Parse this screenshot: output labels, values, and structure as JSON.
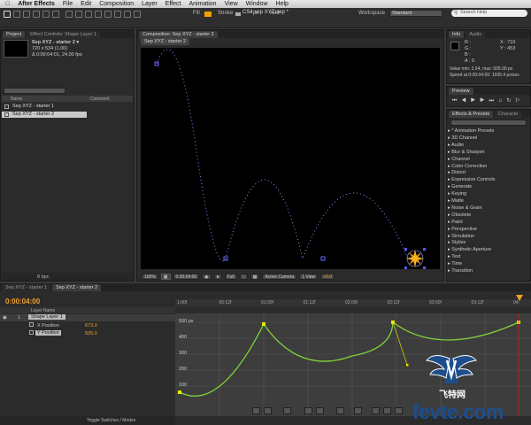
{
  "menubar": {
    "app": "After Effects",
    "items": [
      "File",
      "Edit",
      "Composition",
      "Layer",
      "Effect",
      "Animation",
      "View",
      "Window",
      "Help"
    ]
  },
  "window_title": "CS4 sep XYZ.aep *",
  "toolbar": {
    "fill": "Fill",
    "stroke": "Stroke",
    "stroke_width": "- px",
    "add": "Add",
    "workspace_label": "Workspace",
    "workspace_value": "Standard",
    "search_placeholder": "Search Help"
  },
  "project": {
    "tabs": [
      "Project",
      "Effect Controls: Shape Layer 1"
    ],
    "selected_name": "Sep XYZ - starter 2 ▾",
    "dims": "720 x 534 (1.00)",
    "duration": "Δ 0:00:04:01, 24.00 fps",
    "col_name": "Name",
    "col_comment": "Comment",
    "items": [
      "Sep XYZ - starter 1",
      "Sep XYZ - starter 2"
    ],
    "bpc": "8 bpc"
  },
  "comp": {
    "tab": "Composition: Sep XYZ - starter 2",
    "subtab": "Sep XYZ - starter 2",
    "zoom": "100%",
    "time": "0:00:04:00",
    "resolution": "Full",
    "camera": "Active Camera",
    "views": "1 View",
    "exposure": "+0.0"
  },
  "info": {
    "tabs": [
      "Info",
      "Audio"
    ],
    "r": "R :",
    "g": "G :",
    "b": "B :",
    "a": "A : 0",
    "x": "X : 716",
    "y": "Y : 453",
    "line1": "Value min: 2.54, max: 505.00 px",
    "line2": "Speed at 0:00:04:00: 1935.4 px/sec"
  },
  "preview": {
    "tab": "Preview"
  },
  "effects": {
    "tabs": [
      "Effects & Presets",
      "Characte"
    ],
    "items": [
      "* Animation Presets",
      "3D Channel",
      "Audio",
      "Blur & Sharpen",
      "Channel",
      "Color Correction",
      "Distort",
      "Expression Controls",
      "Generate",
      "Keying",
      "Matte",
      "Noise & Grain",
      "Obsolete",
      "Paint",
      "Perspective",
      "Simulation",
      "Stylize",
      "Synthetic Aperture",
      "Text",
      "Time",
      "Transition"
    ]
  },
  "timeline": {
    "tabs": [
      "Sep XYZ - starter 1",
      "Sep XYZ - starter 2"
    ],
    "timecode": "0:00:04:00",
    "col_layer": "Layer Name",
    "layer_num": "1",
    "layer_name": "Shape Layer 1",
    "x_label": "X Position",
    "x_value": "673.0",
    "y_label": "Y Position",
    "y_value": "505.0",
    "ruler": [
      "1:00f",
      "00:12f",
      "01:00f",
      "01:12f",
      "02:00f",
      "02:12f",
      "03:00f",
      "03:12f",
      "04:"
    ],
    "y_axis": [
      "500 px",
      "400",
      "300",
      "200",
      "100"
    ],
    "toggle": "Toggle Switches / Modes"
  },
  "watermark": {
    "logo_text": "飞特网",
    "site": "fevte.com"
  },
  "colors": {
    "graph_curve": "#7fd23a",
    "accent": "#f0a030",
    "motion_path": "#8a8aff",
    "playhead": "#d02020"
  }
}
